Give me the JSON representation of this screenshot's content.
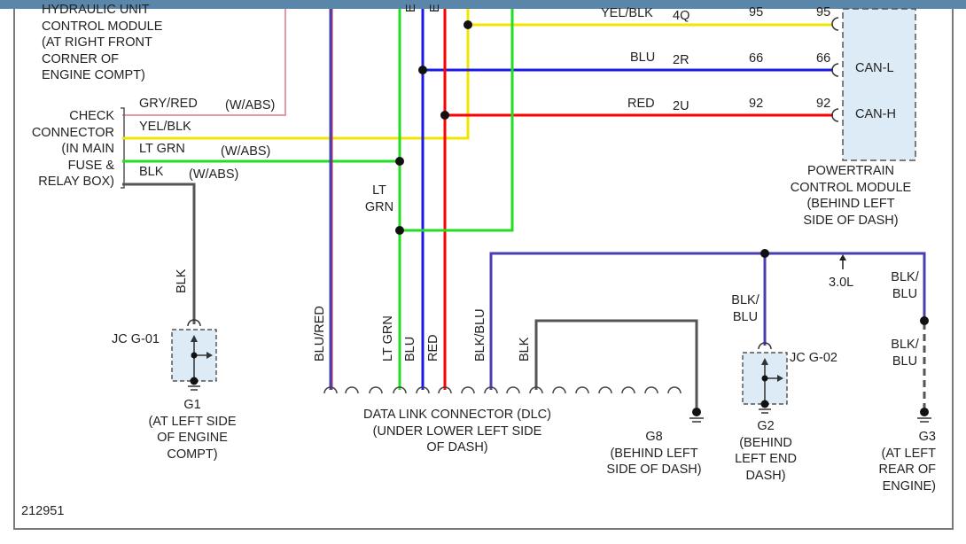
{
  "components": {
    "hydraulic_unit": "HYDRAULIC UNIT\nCONTROL MODULE\n(AT RIGHT FRONT\nCORNER OF\nENGINE COMPT)",
    "check_connector": "CHECK\nCONNECTOR\n(IN MAIN\nFUSE &\nRELAY BOX)",
    "pcm": "POWERTRAIN\nCONTROL MODULE\n(BEHIND LEFT\nSIDE OF DASH)",
    "dlc": "DATA LINK CONNECTOR (DLC)\n(UNDER LOWER LEFT SIDE\nOF DASH)",
    "g1": "G1\n(AT LEFT SIDE\nOF ENGINE\nCOMPT)",
    "g8": "G8\n(BEHIND LEFT\nSIDE OF DASH)",
    "g2": "G2\n(BEHIND\nLEFT END\nDASH)",
    "g3": "G3\n(AT LEFT\nREAR OF\nENGINE)"
  },
  "junctions": {
    "jc_g01": "JC G-01",
    "jc_g02": "JC G-02"
  },
  "pcm_pins": {
    "can_l": "CAN-L",
    "can_h": "CAN-H",
    "rows": [
      {
        "color": "YEL/BLK",
        "circuit": "4Q",
        "pin_a": "95",
        "pin_b": "95"
      },
      {
        "color": "BLU",
        "circuit": "2R",
        "pin_a": "66",
        "pin_b": "66"
      },
      {
        "color": "RED",
        "circuit": "2U",
        "pin_a": "92",
        "pin_b": "92"
      }
    ]
  },
  "check_wires": {
    "gry_red": "GRY/RED",
    "gry_red_note": "(W/ABS)",
    "yel_blk": "YEL/BLK",
    "lt_grn": "LT GRN",
    "lt_grn_note": "(W/ABS)",
    "blk": "BLK",
    "blk_note": "(W/ABS)"
  },
  "vertical_labels": {
    "blk_g1": "BLK",
    "lt_grn_mid": "LT\nGRN",
    "blu_red": "BLU/RED",
    "lt_grn": "LT GRN",
    "blu": "BLU",
    "red": "RED",
    "blk_blu": "BLK/BLU",
    "blk": "BLK"
  },
  "ground_labels": {
    "blk_blu_g2": "BLK/\nBLU",
    "blk_blu_g3a": "BLK/\nBLU",
    "blk_blu_g3b": "BLK/\nBLU",
    "length": "3.0L"
  },
  "top_partial": {
    "e1": "E",
    "e2": "E"
  },
  "diagram_id": "212951",
  "colors": {
    "yellow": "#f2e600",
    "blue": "#1a1ae6",
    "red": "#ff0000",
    "green": "#22dd22",
    "gray": "#555555",
    "navy": "#4a3fb0",
    "pink": "#e49aa0",
    "module_fill": "#dcebf5"
  }
}
